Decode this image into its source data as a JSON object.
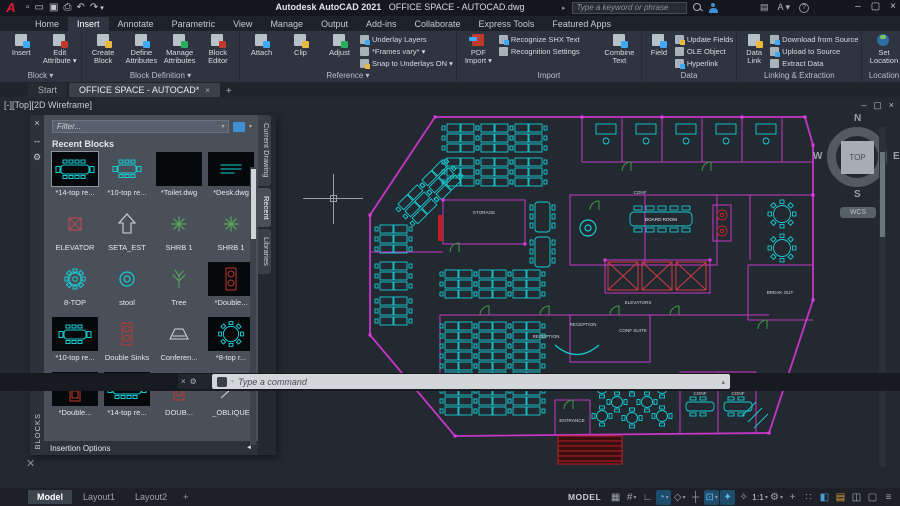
{
  "title_bar": {
    "app_title": "Autodesk AutoCAD 2021",
    "doc_title": "OFFICE SPACE - AUTOCAD.dwg",
    "search_placeholder": "Type a keyword or phrase",
    "qat_icons": [
      "new-file-icon",
      "open-file-icon",
      "save-icon",
      "plot-icon",
      "undo-icon",
      "redo-icon"
    ],
    "account_icons": [
      "cart-icon",
      "autodesk-account-icon",
      "help-icon"
    ],
    "window": {
      "minimize": "–",
      "restore": "▢",
      "close": "×"
    }
  },
  "ribbon_tabs": [
    {
      "label": "Home",
      "active": false
    },
    {
      "label": "Insert",
      "active": true
    },
    {
      "label": "Annotate",
      "active": false
    },
    {
      "label": "Parametric",
      "active": false
    },
    {
      "label": "View",
      "active": false
    },
    {
      "label": "Manage",
      "active": false
    },
    {
      "label": "Output",
      "active": false
    },
    {
      "label": "Add-ins",
      "active": false
    },
    {
      "label": "Collaborate",
      "active": false
    },
    {
      "label": "Express Tools",
      "active": false
    },
    {
      "label": "Featured Apps",
      "active": false
    }
  ],
  "ribbon": {
    "block": {
      "label": "Block ▾",
      "insert": "Insert",
      "edit_attribute": "Edit\nAttribute ▾"
    },
    "block_definition": {
      "label": "Block Definition ▾",
      "create_block": "Create\nBlock",
      "define_attributes": "Define\nAttributes",
      "manage_attributes": "Manage\nAttributes",
      "block_editor": "Block\nEditor"
    },
    "reference": {
      "label": "Reference ▾",
      "attach": "Attach",
      "clip": "Clip",
      "adjust": "Adjust",
      "underlay_layers": "Underlay Layers",
      "frames_vary": "*Frames vary* ▾",
      "snap_underlays": "Snap to Underlays ON ▾"
    },
    "import": {
      "label": "Import",
      "pdf_import": "PDF\nImport ▾",
      "recognize_shx": "Recognize SHX Text",
      "recognition_settings": "Recognition Settings",
      "combine_text": "Combine\nText"
    },
    "data": {
      "label": "Data",
      "field": "Field",
      "update_fields": "Update Fields",
      "ole_object": "OLE Object",
      "hyperlink": "Hyperlink"
    },
    "linking": {
      "label": "Linking & Extraction",
      "data_link": "Data\nLink",
      "download": "Download from Source",
      "upload": "Upload to Source",
      "extract": "Extract  Data"
    },
    "location": {
      "label": "Location",
      "set_location": "Set\nLocation"
    }
  },
  "file_tabs": {
    "tabs": [
      {
        "label": "Start",
        "active": false,
        "closable": false
      },
      {
        "label": "OFFICE SPACE - AUTOCAD*",
        "active": true,
        "closable": true
      }
    ],
    "close_glyph": "×",
    "plus": "+"
  },
  "viewport_label": "[-][Top][2D Wireframe]",
  "blocks_palette": {
    "filter_placeholder": "Filter...",
    "section_title": "Recent Blocks",
    "footer_label": "Insertion Options",
    "footer_arrow": "◄",
    "side_label": "BLOCKS",
    "rail_icons": [
      "close-icon",
      "auto-hide-icon",
      "properties-icon"
    ],
    "tabs": [
      {
        "label": "Current Drawing",
        "active": false
      },
      {
        "label": "Recent",
        "active": true
      },
      {
        "label": "Libraries",
        "active": false
      }
    ],
    "items": [
      {
        "label": "*14-top re...",
        "kind": "thumb-table14",
        "selected": true
      },
      {
        "label": "*10-top re...",
        "kind": "plain-table10",
        "selected": false
      },
      {
        "label": "*Toilet.dwg",
        "kind": "thumb-empty",
        "selected": false
      },
      {
        "label": "*Desk.dwg",
        "kind": "thumb-desk",
        "selected": false
      },
      {
        "label": "ELEVATOR",
        "kind": "icon-elevator",
        "selected": false
      },
      {
        "label": "SETA_EST",
        "kind": "icon-arrow",
        "selected": false
      },
      {
        "label": "SHRB 1",
        "kind": "icon-shrub",
        "selected": false
      },
      {
        "label": "SHRB 1",
        "kind": "icon-shrub",
        "selected": false
      },
      {
        "label": "8-TOP",
        "kind": "icon-gear",
        "selected": false
      },
      {
        "label": "stool",
        "kind": "icon-ring",
        "selected": false
      },
      {
        "label": "Tree",
        "kind": "icon-tree",
        "selected": false
      },
      {
        "label": "*Double...",
        "kind": "thumb-sink",
        "selected": false
      },
      {
        "label": "*10-top re...",
        "kind": "thumb-table10",
        "selected": false
      },
      {
        "label": "Double Sinks",
        "kind": "icon-sink",
        "selected": false
      },
      {
        "label": "Conferen...",
        "kind": "icon-conference",
        "selected": false
      },
      {
        "label": "*8-top r...",
        "kind": "thumb-round8",
        "selected": false
      },
      {
        "label": "*Double...",
        "kind": "thumb-double",
        "selected": false
      },
      {
        "label": "*14-top re...",
        "kind": "thumb-table14",
        "selected": false
      },
      {
        "label": "DOUB...",
        "kind": "icon-sink",
        "selected": false
      },
      {
        "label": "_OBLIQUE",
        "kind": "icon-oblique",
        "selected": false
      }
    ]
  },
  "viewcube": {
    "n": "N",
    "e": "E",
    "s": "S",
    "w": "W",
    "top": "TOP",
    "wcs": "WCS"
  },
  "floor_plan": {
    "labels": {
      "storage": "STORAGE",
      "board_room": "BOARD ROOM",
      "break_out": "BREAK OUT",
      "elevators": "ELEVATORS",
      "reception": "RECEPTION",
      "reception2": "RECEPTION",
      "conf_suite": "CONF SUITE",
      "entrance": "ENTRANCE",
      "conf": "CONF"
    },
    "colors": {
      "wall": "#c736c7",
      "furniture": "#17cdd4",
      "accent_red": "#c2282e",
      "door_green": "#3f9b3f",
      "grip": "#e23ae2"
    }
  },
  "command_line": {
    "placeholder": "Type a command"
  },
  "status_bar": {
    "layout_tabs": [
      {
        "label": "Model",
        "active": true
      },
      {
        "label": "Layout1",
        "active": false
      },
      {
        "label": "Layout2",
        "active": false
      }
    ],
    "plus": "+",
    "model_badge": "MODEL",
    "icons": [
      {
        "name": "grid-icon",
        "glyph": "▦",
        "active": false,
        "dd": false
      },
      {
        "name": "snap-icon",
        "glyph": "#",
        "active": false,
        "dd": true
      },
      {
        "name": "ortho-icon",
        "glyph": "∟",
        "active": false,
        "dd": false
      },
      {
        "name": "polar-tracking-icon",
        "glyph": "◔",
        "active": true,
        "dd": true
      },
      {
        "name": "isodraft-icon",
        "glyph": "◇",
        "active": false,
        "dd": true
      },
      {
        "name": "osnap-tracking-icon",
        "glyph": "┼",
        "active": false,
        "dd": false
      },
      {
        "name": "osnap-icon",
        "glyph": "⊡",
        "active": true,
        "dd": true
      },
      {
        "name": "annotation-visibility-icon",
        "glyph": "✦",
        "active": true,
        "dd": false
      },
      {
        "name": "annotation-autoscale-icon",
        "glyph": "✧",
        "active": false,
        "dd": false
      },
      {
        "name": "annotation-scale",
        "label": "1:1",
        "active": false,
        "dd": true
      },
      {
        "name": "workspace-icon",
        "glyph": "⚙",
        "active": false,
        "dd": true
      },
      {
        "name": "plus-icon",
        "glyph": "+",
        "active": false,
        "dd": false
      },
      {
        "name": "isolate-icon",
        "glyph": "∷",
        "active": false,
        "dd": false
      },
      {
        "name": "graphics-performance-icon",
        "glyph": "◧",
        "active": false,
        "dd": false,
        "tint": "#4a9eda"
      },
      {
        "name": "units-icon",
        "glyph": "▤",
        "active": false,
        "dd": false,
        "tint": "#d8a33b"
      },
      {
        "name": "screen-icon",
        "glyph": "◫",
        "active": false,
        "dd": false,
        "tint": "#9fb6c8"
      },
      {
        "name": "clean-screen-icon",
        "glyph": "▢",
        "active": false,
        "dd": false
      },
      {
        "name": "customization-icon",
        "glyph": "≡",
        "active": false,
        "dd": false
      }
    ]
  }
}
